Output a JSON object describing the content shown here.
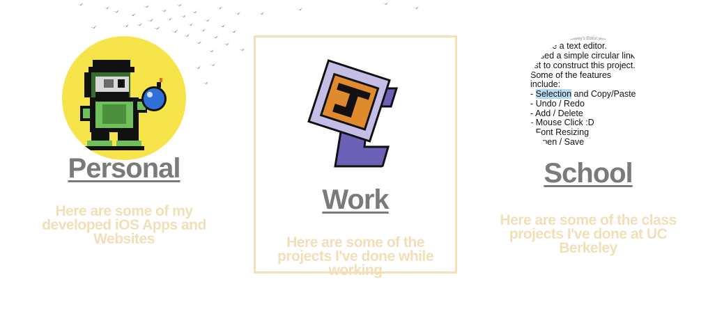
{
  "cards": [
    {
      "id": "personal",
      "title": "Personal",
      "description": "Here are some of my developed iOS Apps and Websites",
      "image": "pixel-art-character-with-bomb",
      "image_bg": "#f7e34a"
    },
    {
      "id": "work",
      "title": "Work",
      "description": "Here are some of the projects I've done while working",
      "image": "jc-logo",
      "border_color": "#f3e0b8"
    },
    {
      "id": "school",
      "title": "School",
      "description": "Here are some of the class projects I've done at UC Berkeley",
      "image": "text-editor-screenshot",
      "editor": {
        "window_title": "Davey's Editor.java",
        "lines": [
          "I made a text editor.",
          "I used a simple circular linked",
          "list to construct this project.",
          "Some of the features",
          "include:",
          "- Selection and Copy/Paste",
          "- Undo / Redo",
          "- Add / Delete",
          "- Mouse Click :D",
          "- Font Resizing",
          "- Open / Save"
        ],
        "highlight": "Selection"
      }
    }
  ],
  "colors": {
    "title": "#7a7a7a",
    "description": "#f1dfb8",
    "accent_border": "#f3e0b8",
    "yellow": "#f7e34a"
  }
}
